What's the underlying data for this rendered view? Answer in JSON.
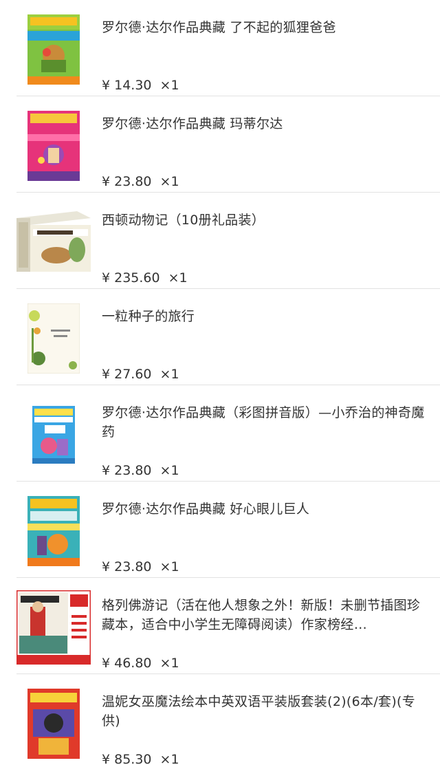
{
  "cart": {
    "items": [
      {
        "title": "罗尔德·达尔作品典藏 了不起的狐狸爸爸",
        "price": "¥ 14.30",
        "qty": "×1",
        "cover": "green-orange-book-cover"
      },
      {
        "title": "罗尔德·达尔作品典藏 玛蒂尔达",
        "price": "¥ 23.80",
        "qty": "×1",
        "cover": "pink-purple-book-cover"
      },
      {
        "title": "西顿动物记（10册礼品装）",
        "price": "¥ 235.60",
        "qty": "×1",
        "cover": "boxed-set-cover"
      },
      {
        "title": "一粒种子的旅行",
        "price": "¥ 27.60",
        "qty": "×1",
        "cover": "white-botanical-book-cover"
      },
      {
        "title": "罗尔德·达尔作品典藏（彩图拼音版）—小乔治的神奇魔药",
        "price": "¥ 23.80",
        "qty": "×1",
        "cover": "blue-book-cover"
      },
      {
        "title": "罗尔德·达尔作品典藏 好心眼儿巨人",
        "price": "¥ 23.80",
        "qty": "×1",
        "cover": "teal-orange-book-cover"
      },
      {
        "title": "格列佛游记（活在他人想象之外！新版！未删节插图珍藏本，适合中小学生无障碍阅读）作家榜经…",
        "price": "¥ 46.80",
        "qty": "×1",
        "cover": "red-bordered-book-cover"
      },
      {
        "title": "温妮女巫魔法绘本中英双语平装版套装(2)(6本/套)(专供)",
        "price": "¥ 85.30",
        "qty": "×1",
        "cover": "red-box-set-cover"
      }
    ]
  },
  "colors": {
    "separator": "#e2e2e2",
    "text": "#333333"
  }
}
